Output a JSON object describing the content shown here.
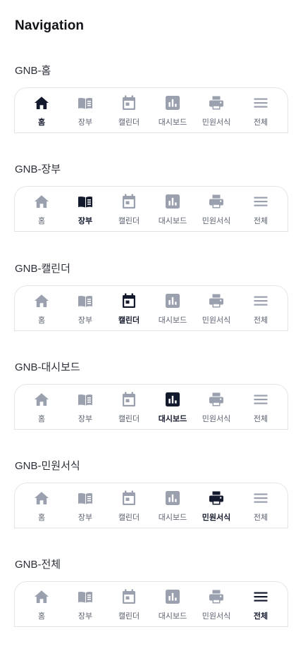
{
  "page_title": "Navigation",
  "nav_labels": {
    "home": "홈",
    "ledger": "장부",
    "calendar": "캘린더",
    "dashboard": "대시보드",
    "forms": "민원서식",
    "all": "전체"
  },
  "sections": [
    {
      "label": "GNB-홈",
      "active": "home"
    },
    {
      "label": "GNB-장부",
      "active": "ledger"
    },
    {
      "label": "GNB-캘린더",
      "active": "calendar"
    },
    {
      "label": "GNB-대시보드",
      "active": "dashboard"
    },
    {
      "label": "GNB-민원서식",
      "active": "forms"
    },
    {
      "label": "GNB-전체",
      "active": "all"
    }
  ],
  "colors": {
    "active": "#141a2d",
    "inactive_icon": "#9aa0ad",
    "inactive_text": "#5b6170",
    "border": "#e3e5ea"
  },
  "icons": {
    "home": "home-icon",
    "ledger": "book-icon",
    "calendar": "calendar-icon",
    "dashboard": "bar-chart-icon",
    "forms": "printer-icon",
    "all": "menu-icon"
  }
}
